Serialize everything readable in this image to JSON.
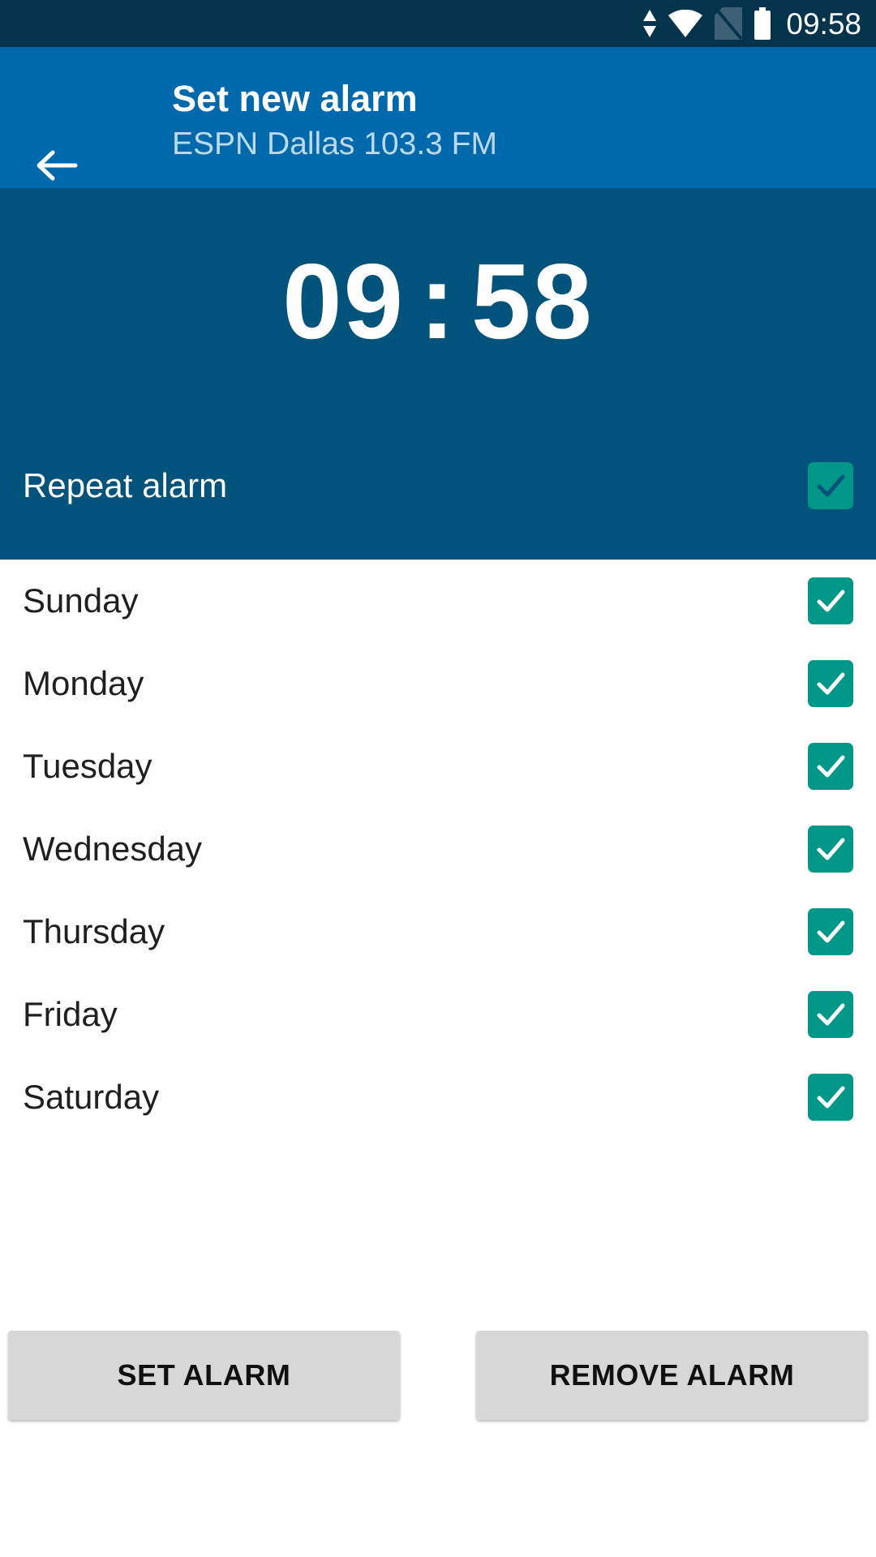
{
  "status_bar": {
    "time": "09:58",
    "icons": [
      {
        "name": "data-transfer-icon"
      },
      {
        "name": "wifi-icon"
      },
      {
        "name": "no-sim-icon"
      },
      {
        "name": "battery-icon"
      }
    ],
    "background_color": "#04344c"
  },
  "app_bar": {
    "back_icon": "arrow-left-icon",
    "title": "Set new alarm",
    "subtitle": "ESPN Dallas 103.3 FM",
    "background_color": "#0069ac"
  },
  "hero": {
    "hours": "09",
    "separator": ":",
    "minutes": "58",
    "background_color": "#01537c",
    "repeat": {
      "label": "Repeat alarm",
      "checked": true
    }
  },
  "days": [
    {
      "label": "Sunday",
      "checked": true
    },
    {
      "label": "Monday",
      "checked": true
    },
    {
      "label": "Tuesday",
      "checked": true
    },
    {
      "label": "Wednesday",
      "checked": true
    },
    {
      "label": "Thursday",
      "checked": true
    },
    {
      "label": "Friday",
      "checked": true
    },
    {
      "label": "Saturday",
      "checked": true
    }
  ],
  "footer": {
    "set_label": "SET ALARM",
    "remove_label": "REMOVE ALARM",
    "button_color": "#d7d7d7"
  },
  "colors": {
    "accent_teal": "#009688",
    "status_bar": "#04344c",
    "app_bar": "#0069ac",
    "hero": "#01537c"
  }
}
